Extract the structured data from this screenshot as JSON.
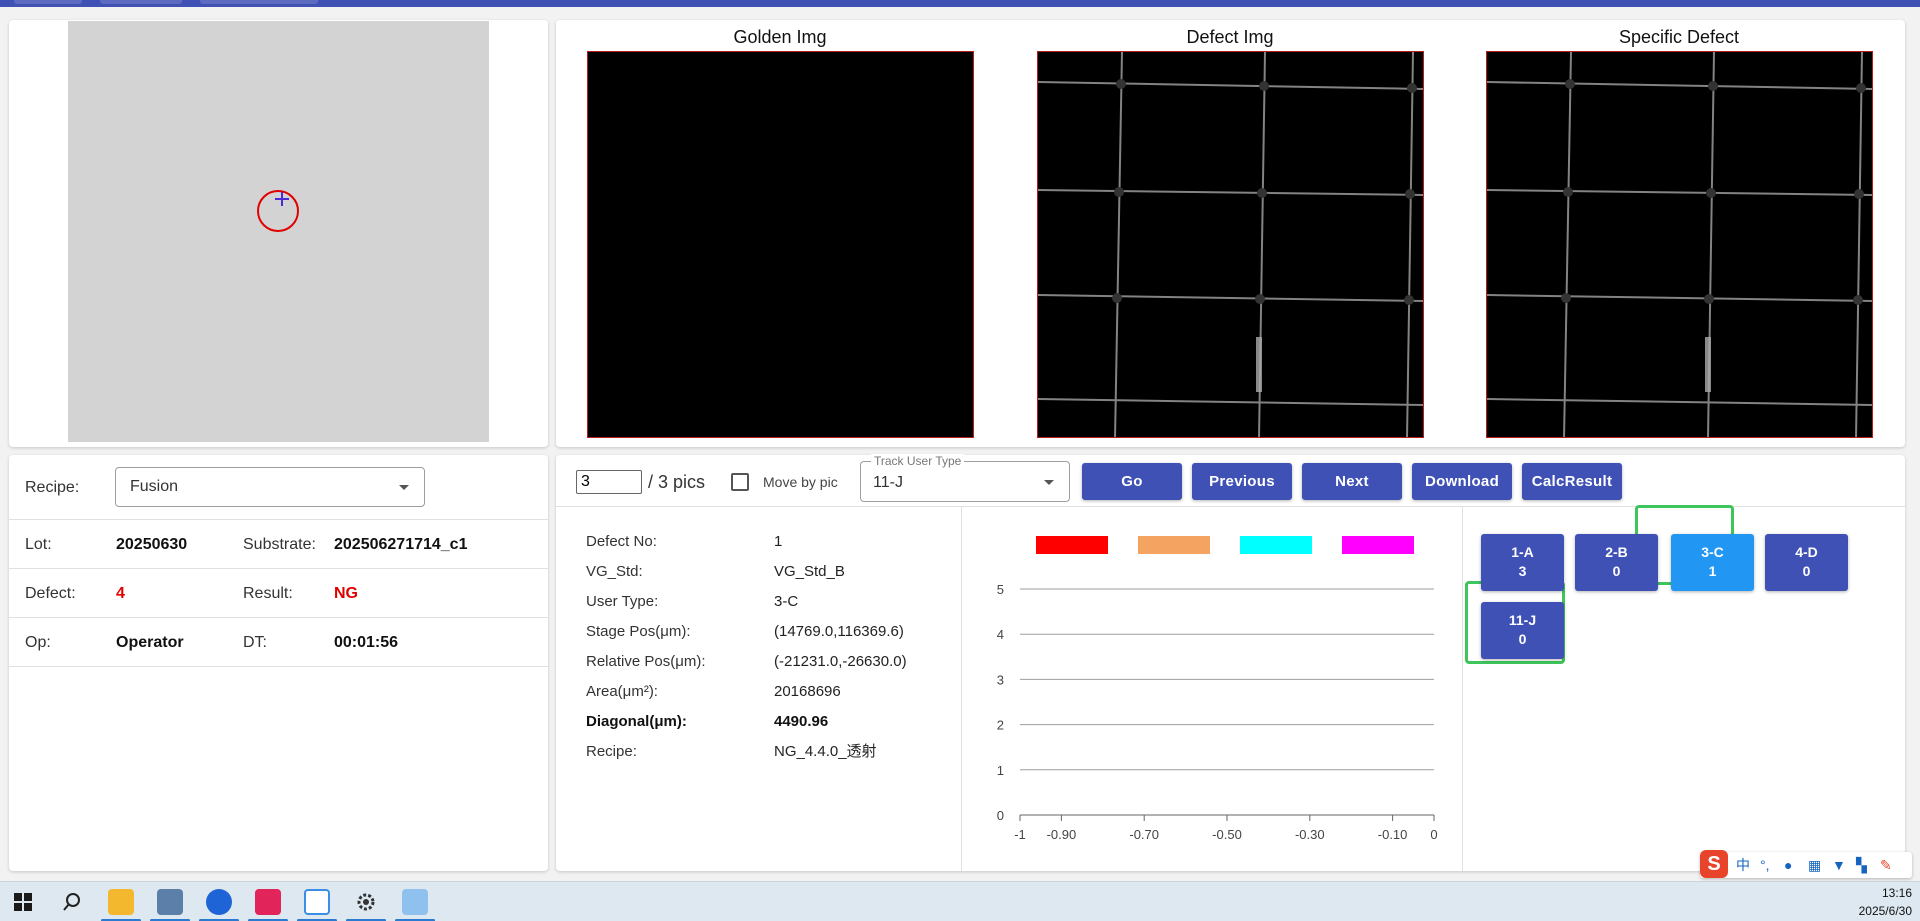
{
  "images": {
    "golden_title": "Golden Img",
    "defect_title": "Defect Img",
    "specific_title": "Specific Defect"
  },
  "info": {
    "recipe_label": "Recipe:",
    "recipe_value": "Fusion",
    "lot_label": "Lot:",
    "lot_value": "20250630",
    "substrate_label": "Substrate:",
    "substrate_value": "202506271714_c1",
    "defect_label": "Defect:",
    "defect_value": "4",
    "result_label": "Result:",
    "result_value": "NG",
    "op_label": "Op:",
    "op_value": "Operator",
    "dt_label": "DT:",
    "dt_value": "00:01:56",
    "accent_red": "#e00000"
  },
  "controls": {
    "page_value": "3",
    "pics_label": "/ 3 pics",
    "move_by_pic_label": "Move by pic",
    "track_user_type_label": "Track User Type",
    "track_user_type_value": "11-J",
    "go_label": "Go",
    "previous_label": "Previous",
    "next_label": "Next",
    "download_label": "Download",
    "calc_result_label": "CalcResult",
    "button_color": "#3f51b5"
  },
  "details": {
    "rows": [
      {
        "k": "Defect No:",
        "v": "1"
      },
      {
        "k": "VG_Std:",
        "v": "VG_Std_B"
      },
      {
        "k": "User Type:",
        "v": "3-C"
      },
      {
        "k": "Stage Pos(μm):",
        "v": "(14769.0,116369.6)"
      },
      {
        "k": "Relative Pos(μm):",
        "v": "(-21231.0,-26630.0)"
      },
      {
        "k": "Area(μm²):",
        "v": "20168696"
      },
      {
        "k": "Diagonal(μm):",
        "v": "4490.96"
      },
      {
        "k": "Recipe:",
        "v": "NG_4.4.0_透射"
      }
    ]
  },
  "chart_data": {
    "type": "bar",
    "title": "",
    "xlabel": "",
    "ylabel": "",
    "series": [
      {
        "color": "#ff0000",
        "values": []
      },
      {
        "color": "#f4a460",
        "values": []
      },
      {
        "color": "#00ffff",
        "values": []
      },
      {
        "color": "#ff00ff",
        "values": []
      }
    ],
    "xlim": [
      -1,
      0
    ],
    "ylim": [
      0,
      5
    ],
    "x_ticks": [
      "-1",
      "-0.90",
      "-0.70",
      "-0.50",
      "-0.30",
      "-0.10",
      "0"
    ],
    "x_tick_values": [
      -1,
      -0.9,
      -0.7,
      -0.5,
      -0.3,
      -0.1,
      0
    ],
    "y_ticks": [
      "0",
      "1",
      "2",
      "3",
      "4",
      "5"
    ],
    "y_tick_values": [
      0,
      1,
      2,
      3,
      4,
      5
    ],
    "grid": "horizontal",
    "legend": "top"
  },
  "types": [
    {
      "name": "1-A",
      "count": "3",
      "active": false
    },
    {
      "name": "2-B",
      "count": "0",
      "active": false
    },
    {
      "name": "3-C",
      "count": "1",
      "active": true
    },
    {
      "name": "4-D",
      "count": "0",
      "active": false
    },
    {
      "name": "11-J",
      "count": "0",
      "active": false
    }
  ],
  "taskbar": {
    "time": "13:16",
    "date": "2025/6/30",
    "icons": [
      "windows-start-icon",
      "search-icon",
      "file-explorer-icon",
      "notepad-icon",
      "browser-icon",
      "media-app-icon",
      "gallery-app-icon",
      "settings-icon",
      "app-icon"
    ]
  },
  "ime": {
    "brand": "S",
    "mode": "中"
  }
}
